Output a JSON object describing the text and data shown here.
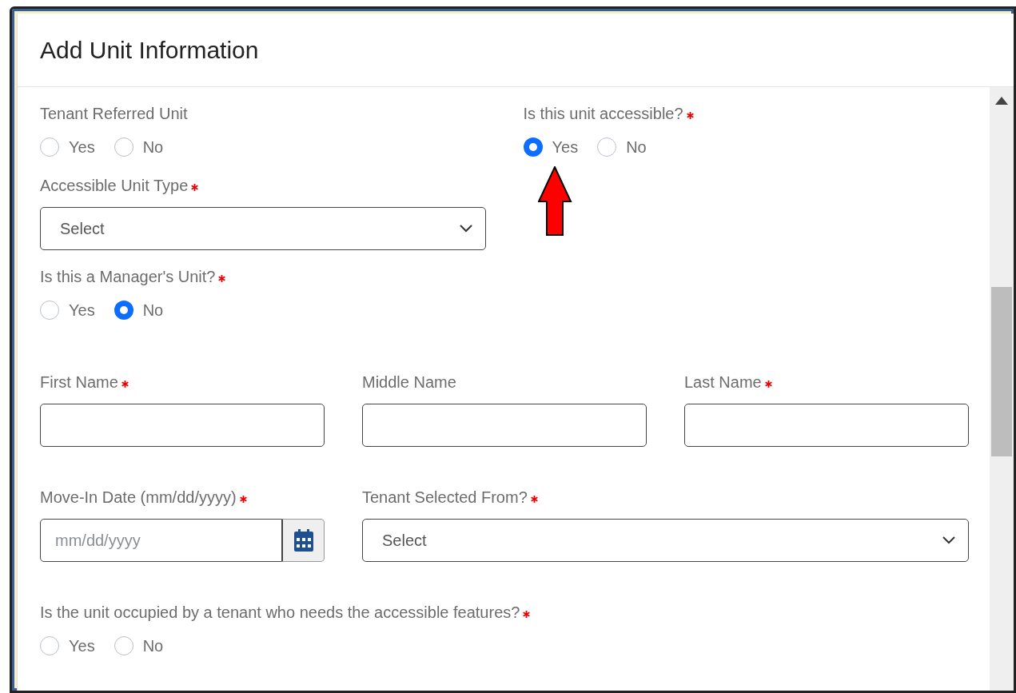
{
  "modal": {
    "title": "Add Unit Information"
  },
  "rows": [
    {
      "fields": [
        {
          "kind": "radio",
          "label": "Tenant Referred Unit",
          "required": false,
          "options": [
            {
              "label": "Yes",
              "selected": false
            },
            {
              "label": "No",
              "selected": false
            }
          ]
        },
        {
          "kind": "radio",
          "label": "Is this unit accessible?",
          "required": true,
          "options": [
            {
              "label": "Yes",
              "selected": true
            },
            {
              "label": "No",
              "selected": false
            }
          ]
        }
      ]
    },
    {
      "fields": [
        {
          "kind": "select",
          "label": "Accessible Unit Type",
          "required": true,
          "value": "Select"
        }
      ]
    },
    {
      "fields": [
        {
          "kind": "radio",
          "label": "Is this a Manager's Unit?",
          "required": true,
          "options": [
            {
              "label": "Yes",
              "selected": false
            },
            {
              "label": "No",
              "selected": true
            }
          ]
        }
      ]
    },
    {
      "fields": [
        {
          "kind": "text",
          "label": "First Name",
          "required": true
        },
        {
          "kind": "text",
          "label": "Middle Name",
          "required": false
        },
        {
          "kind": "text",
          "label": "Last Name",
          "required": true
        }
      ]
    },
    {
      "fields": [
        {
          "kind": "date",
          "label": "Move-In Date (mm/dd/yyyy)",
          "required": true,
          "placeholder": "mm/dd/yyyy"
        },
        {
          "kind": "select",
          "label": "Tenant Selected From?",
          "required": true,
          "value": "Select"
        }
      ]
    },
    {
      "fields": [
        {
          "kind": "radio",
          "label": "Is the unit occupied by a tenant who needs the accessible features?",
          "required": true,
          "options": [
            {
              "label": "Yes",
              "selected": false
            },
            {
              "label": "No",
              "selected": false
            }
          ]
        }
      ]
    }
  ]
}
